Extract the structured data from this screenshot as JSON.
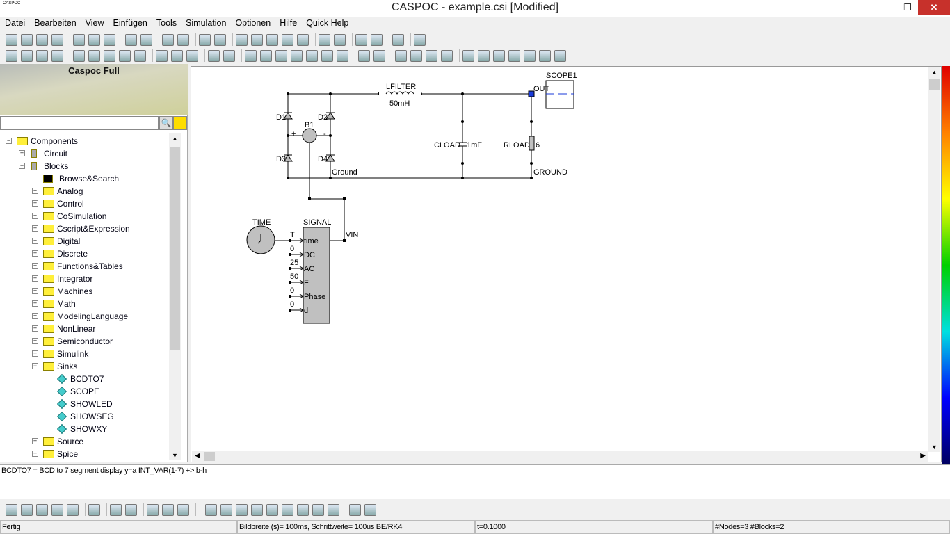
{
  "window": {
    "title": "CASPOC - example.csi [Modified]",
    "app_icon_label": "CASPOC",
    "minimize": "—",
    "maximize": "❐",
    "close": "✕"
  },
  "menu": [
    "Datei",
    "Bearbeiten",
    "View",
    "Einfügen",
    "Tools",
    "Simulation",
    "Optionen",
    "Hilfe",
    "Quick Help"
  ],
  "toolbar1": [
    "new-file-icon",
    "open-folder-icon",
    "save-icon",
    "print-icon",
    "|",
    "cut-icon",
    "copy-icon",
    "paste-icon",
    "|",
    "undo-icon",
    "redo-icon",
    "|",
    "run-icon",
    "pause-icon",
    "|",
    "comment-icon",
    "signal-icon",
    "|",
    "hand-icon",
    "draw-icon",
    "list-icon",
    "list-indent-icon",
    "list-options-icon",
    "|",
    "ic-in-icon",
    "ic-out-icon",
    "|",
    "new-library-icon",
    "library-icon",
    "|",
    "hierarchy-icon",
    "|",
    "help-icon"
  ],
  "toolbar2": [
    "zoom-100-icon",
    "zoom-fit-icon",
    "zoom-width-icon",
    "zoom-height-icon",
    "|",
    "wire-icon",
    "component-icon",
    "block-icon",
    "block2-icon",
    "filter-icon",
    "|",
    "globe-icon",
    "globe-block-icon",
    "globe-link-icon",
    "|",
    "probe-icon",
    "text-icon",
    "|",
    "3d-icon",
    "node-icon",
    "arrow-icon",
    "arrow-color-icon",
    "green-block-icon",
    "number-icon",
    "wand-icon",
    "|",
    "junction-icon",
    "grid-icon",
    "|",
    "clock-icon",
    "paint-icon",
    "level-icon",
    "bar-icon",
    "|",
    "target-icon",
    "colors-icon",
    "sort-icon",
    "chip-icon",
    "chip2-icon",
    "chip3-icon",
    "table-icon"
  ],
  "bottom_toolbar": [
    "block-icon",
    "document-icon",
    "number-display-icon",
    "grid-icon",
    "component-icon",
    "|",
    "refresh-icon",
    "|",
    "window-icon",
    "window2-icon",
    "|",
    "scope-icon",
    "library-icon",
    "tools-icon",
    "|",
    "|",
    "record-icon",
    "first-icon",
    "fast-back-icon",
    "back-icon",
    "step-back-icon",
    "step-forward-icon",
    "forward-icon",
    "fast-forward-icon",
    "last-icon",
    "|",
    "copy-window-icon",
    "pages-icon"
  ],
  "panel": {
    "banner": "Caspoc Full",
    "search_value": "",
    "search_icon": "magnifier-icon",
    "library_icon": "library-icon"
  },
  "tree": [
    {
      "label": "Components",
      "level": 0,
      "exp": "−",
      "icon": "folder"
    },
    {
      "label": "Circuit",
      "level": 1,
      "exp": "+",
      "icon": "component"
    },
    {
      "label": "Blocks",
      "level": 1,
      "exp": "−",
      "icon": "block"
    },
    {
      "label": "Browse&Search",
      "level": 2,
      "icon": "binoculars"
    },
    {
      "label": "Analog",
      "level": 2,
      "exp": "+",
      "icon": "folder"
    },
    {
      "label": "Control",
      "level": 2,
      "exp": "+",
      "icon": "folder"
    },
    {
      "label": "CoSimulation",
      "level": 2,
      "exp": "+",
      "icon": "folder"
    },
    {
      "label": "Cscript&Expression",
      "level": 2,
      "exp": "+",
      "icon": "folder"
    },
    {
      "label": "Digital",
      "level": 2,
      "exp": "+",
      "icon": "folder"
    },
    {
      "label": "Discrete",
      "level": 2,
      "exp": "+",
      "icon": "folder"
    },
    {
      "label": "Functions&Tables",
      "level": 2,
      "exp": "+",
      "icon": "folder"
    },
    {
      "label": "Integrator",
      "level": 2,
      "exp": "+",
      "icon": "folder"
    },
    {
      "label": "Machines",
      "level": 2,
      "exp": "+",
      "icon": "folder"
    },
    {
      "label": "Math",
      "level": 2,
      "exp": "+",
      "icon": "folder"
    },
    {
      "label": "ModelingLanguage",
      "level": 2,
      "exp": "+",
      "icon": "folder"
    },
    {
      "label": "NonLinear",
      "level": 2,
      "exp": "+",
      "icon": "folder"
    },
    {
      "label": "Semiconductor",
      "level": 2,
      "exp": "+",
      "icon": "folder"
    },
    {
      "label": "Simulink",
      "level": 2,
      "exp": "+",
      "icon": "folder"
    },
    {
      "label": "Sinks",
      "level": 2,
      "exp": "−",
      "icon": "folder"
    },
    {
      "label": "BCDTO7",
      "level": 3,
      "icon": "leaf"
    },
    {
      "label": "SCOPE",
      "level": 3,
      "icon": "leaf"
    },
    {
      "label": "SHOWLED",
      "level": 3,
      "icon": "leaf"
    },
    {
      "label": "SHOWSEG",
      "level": 3,
      "icon": "leaf"
    },
    {
      "label": "SHOWXY",
      "level": 3,
      "icon": "leaf"
    },
    {
      "label": "Source",
      "level": 2,
      "exp": "+",
      "icon": "folder"
    },
    {
      "label": "Spice",
      "level": 2,
      "exp": "+",
      "icon": "folder"
    }
  ],
  "circuit": {
    "d1": "D1",
    "d2": "D2",
    "d3": "D3",
    "d4": "D4",
    "b1": "B1",
    "plus": "+",
    "minus": "-",
    "lfilter": "LFILTER",
    "lfilter_value": "50mH",
    "cload": "CLOAD",
    "cload_value": "1mF",
    "rload": "RLOAD",
    "rload_value": "6",
    "ground1": "Ground",
    "ground2": "GROUND",
    "scope": "SCOPE1",
    "out": "OUT",
    "vin": "VIN",
    "time": "TIME",
    "signal": "SIGNAL",
    "ports": [
      {
        "name": "time",
        "value": "T"
      },
      {
        "name": "DC",
        "value": "0"
      },
      {
        "name": "AC",
        "value": "25"
      },
      {
        "name": "F",
        "value": "50"
      },
      {
        "name": "Phase",
        "value": "0"
      },
      {
        "name": "d",
        "value": "0"
      }
    ]
  },
  "description": "BCDTO7 = BCD to 7 segment display y=a INT_VAR(1-7) +> b-h",
  "status": {
    "state": "Fertig",
    "sim": "Bildbreite (s)= 100ms, Schrittweite= 100us BE/RK4",
    "time": "t=0.1000",
    "counts": "#Nodes=3 #Blocks=2"
  }
}
